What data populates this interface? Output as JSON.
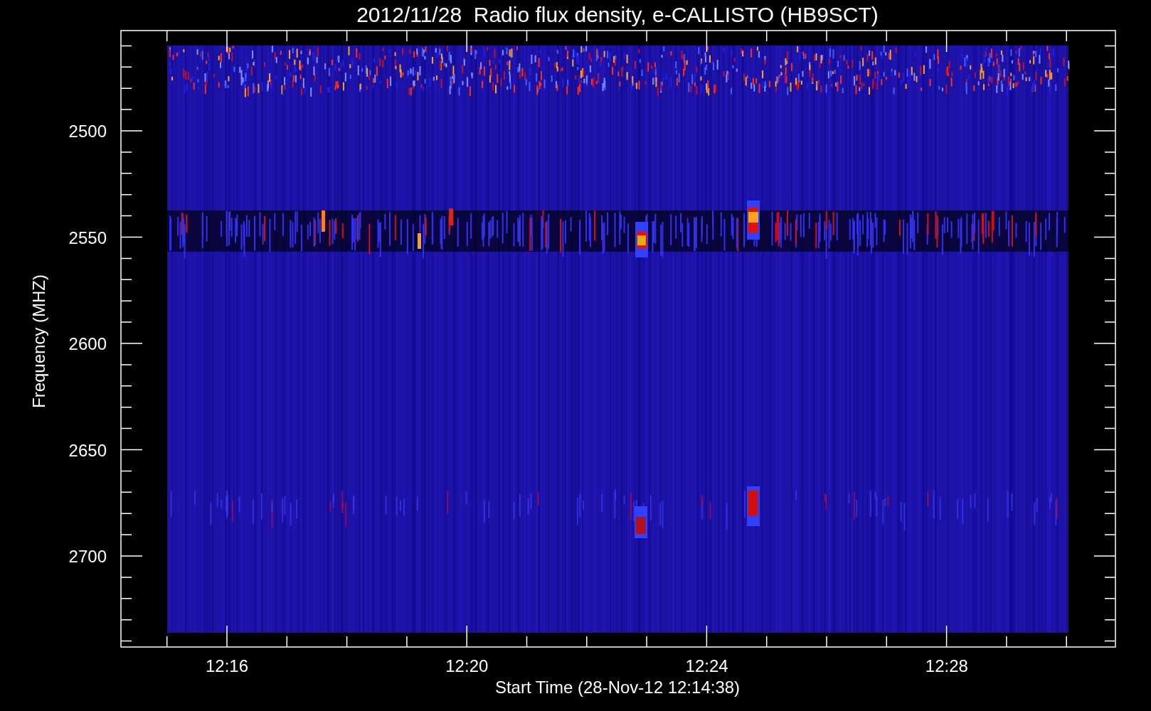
{
  "title": "2012/11/28  Radio flux density, e-CALLISTO (HB9SCT)",
  "y_axis": {
    "label": "Frequency (MHZ)",
    "ticks": [
      "2500",
      "2550",
      "2600",
      "2650",
      "2700"
    ]
  },
  "x_axis": {
    "label": "Start Time (28-Nov-12 12:14:38)",
    "ticks": [
      "12:16",
      "12:20",
      "12:24",
      "12:28"
    ]
  }
}
